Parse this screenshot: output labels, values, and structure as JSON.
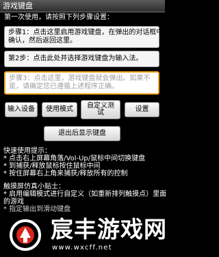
{
  "app": {
    "title": "游戏键盘"
  },
  "intro": "第一次使用，请按照下列步骤设置：",
  "steps": [
    {
      "lines": [
        "步骤1：点击这里启用游戏键盘，在弹出的对话框中",
        "确认，然后返回这里。"
      ]
    },
    {
      "lines": [
        "第2步：点击此处并选择游戏键盘为输入法。"
      ]
    },
    {
      "lines": [
        "步骤3：点击这里，游戏键盘就会弹出。如果不",
        "是，请确定您已遵循上述程序正确。"
      ]
    }
  ],
  "buttons": {
    "input_device": "输入设备",
    "use_mode": "使用模式",
    "custom_test": "自定义测试",
    "settings": "设置",
    "exit": "退出后显示键盘"
  },
  "quick_tips": {
    "heading": "快速使用提示：",
    "items": [
      "* 点击右上屏幕角落/Vol-Up/鼠标中间切换键盘",
      "* 到捕获/释放鼠标按住鼠标中间",
      "* 按住屏幕右上角来捕获/释放所有的控制"
    ]
  },
  "touch_tips": {
    "heading": "触摸屏仿真小贴士：",
    "items": [
      "* 启用编辑模式进行自定义（如重新排列触摸点）里面",
      "的游戏",
      "* 指定输出到滑动键盘"
    ]
  },
  "watermark": {
    "name": "宸丰游戏网",
    "url": "www.wxcff.net"
  },
  "colors": {
    "step3_border": "#f5a623",
    "step3_text": "#9e9e9e",
    "logo_red": "#d9261c"
  }
}
